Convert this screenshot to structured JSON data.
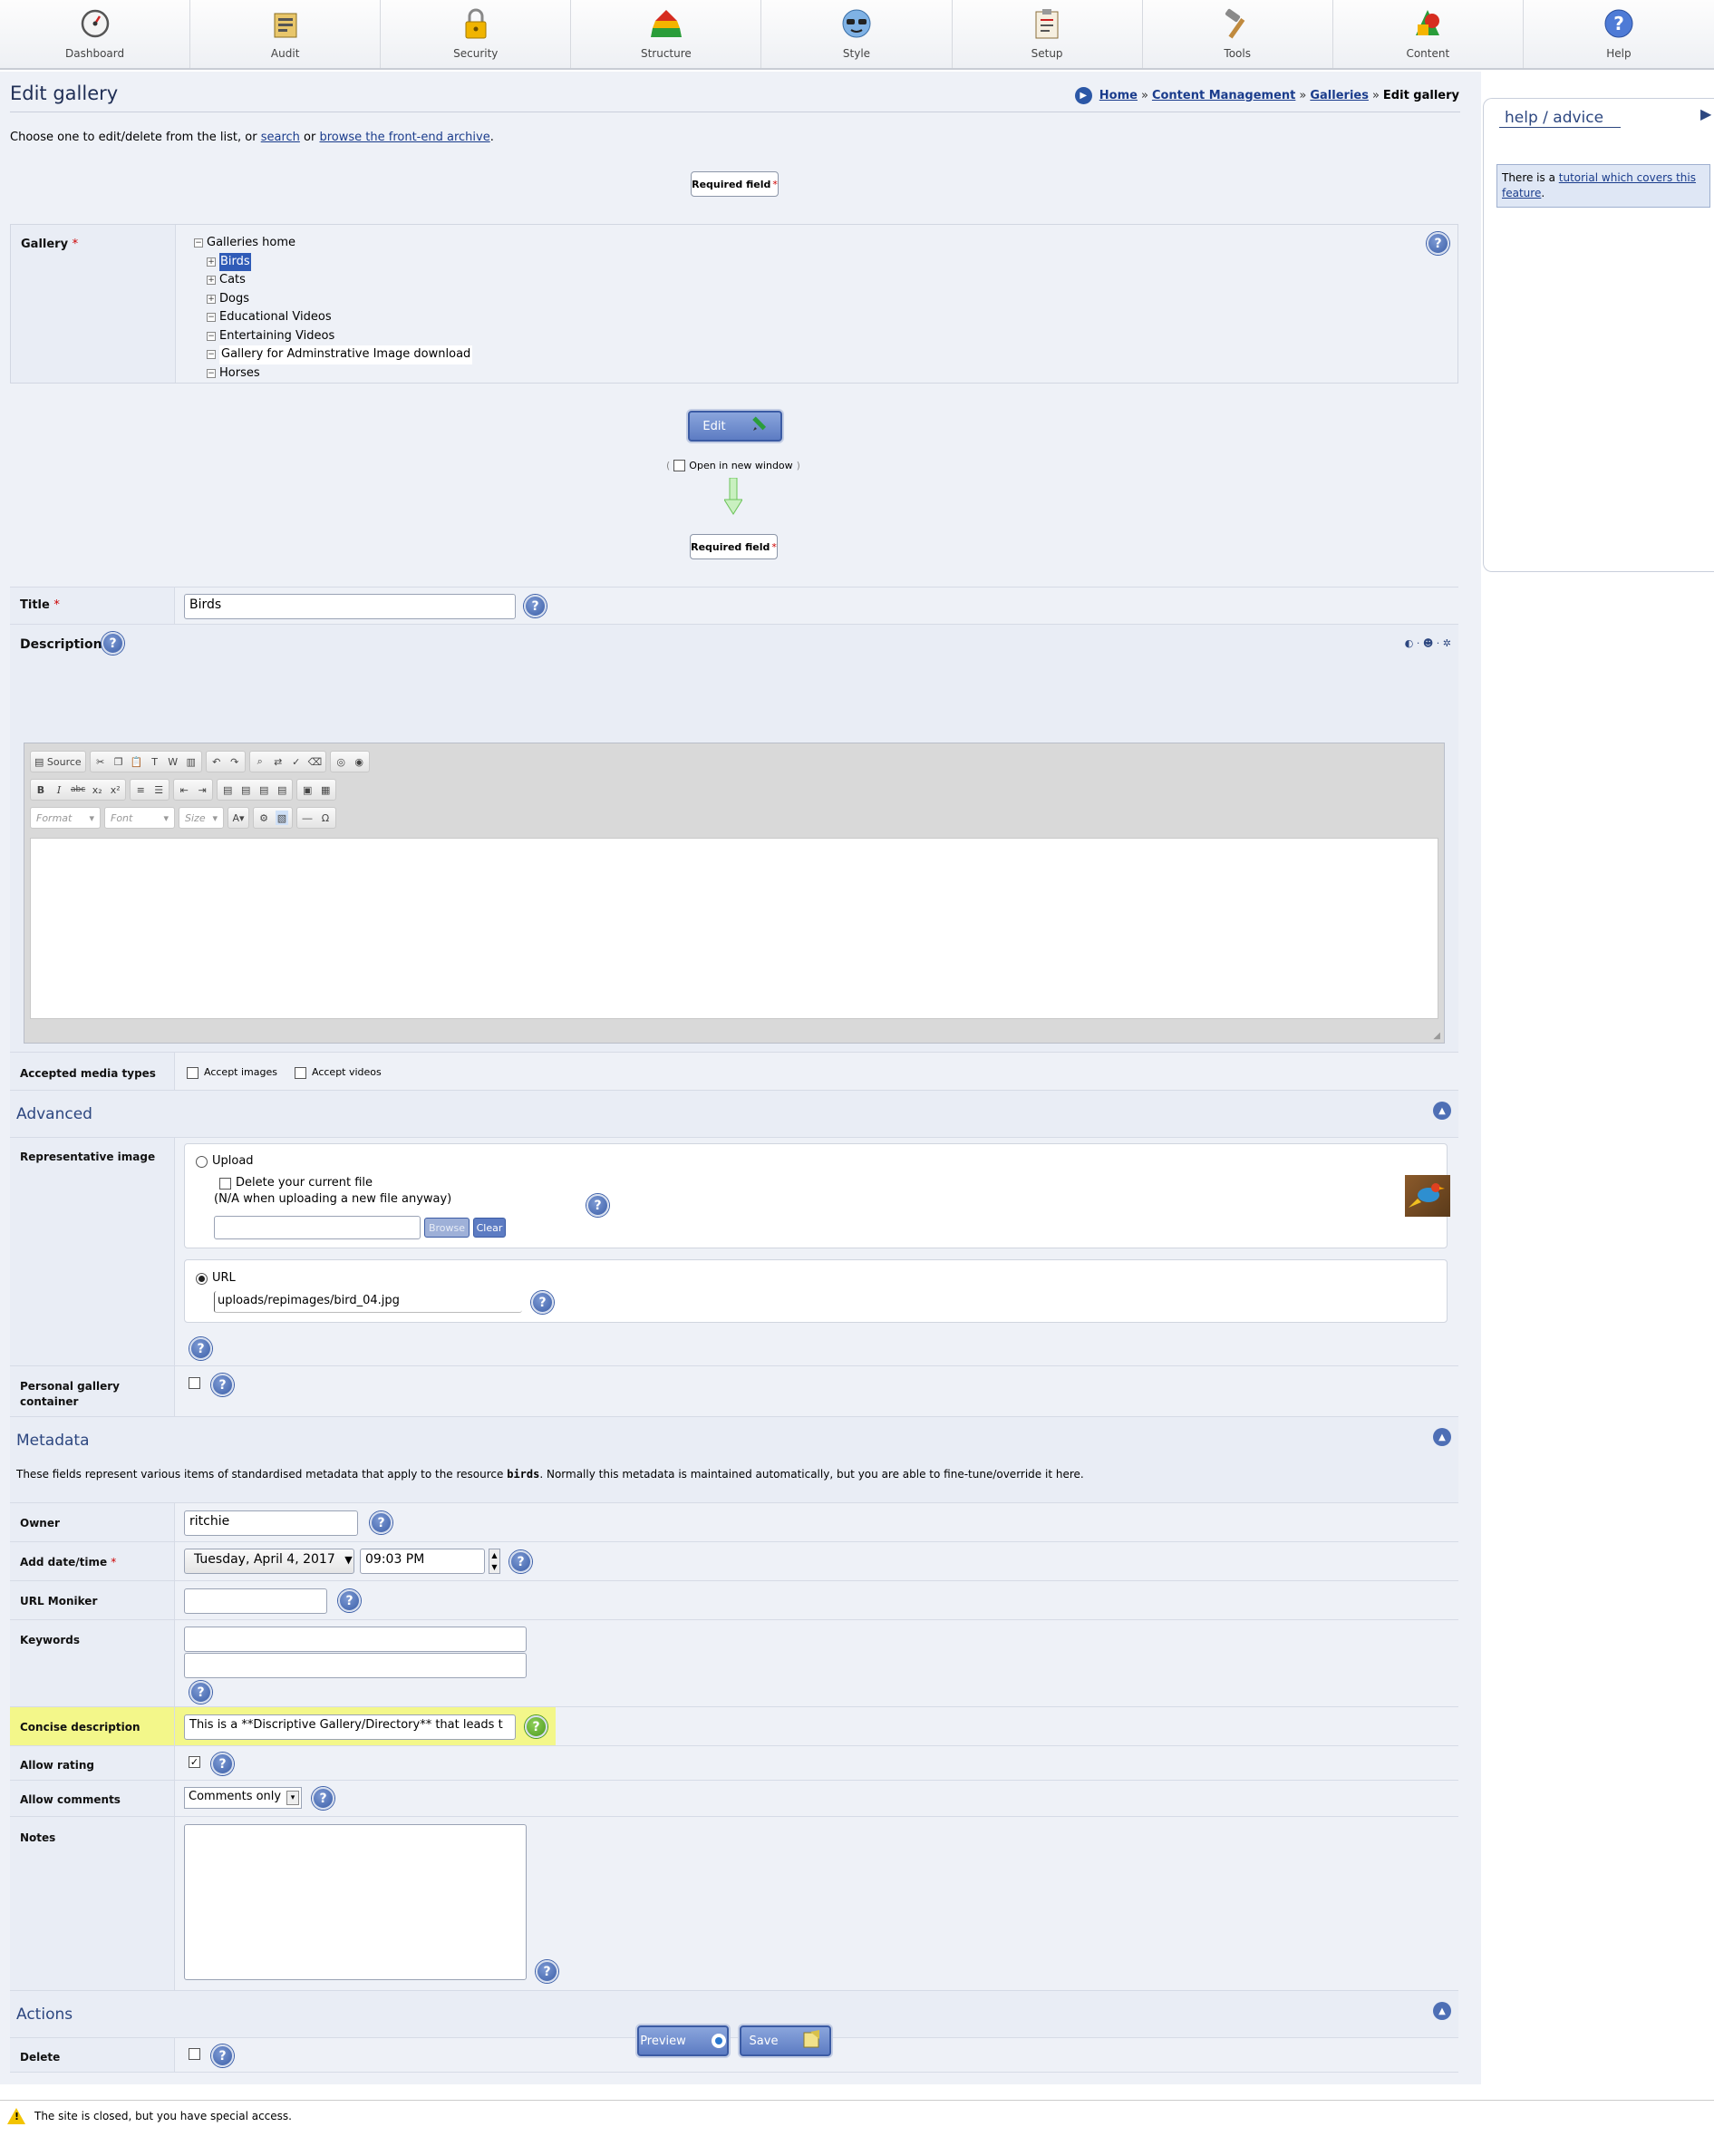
{
  "nav": [
    {
      "label": "Dashboard",
      "icon": "dashboard-icon"
    },
    {
      "label": "Audit",
      "icon": "audit-icon"
    },
    {
      "label": "Security",
      "icon": "padlock-icon"
    },
    {
      "label": "Structure",
      "icon": "pyramid-icon"
    },
    {
      "label": "Style",
      "icon": "sunglasses-face-icon"
    },
    {
      "label": "Setup",
      "icon": "clipboard-icon"
    },
    {
      "label": "Tools",
      "icon": "hammer-icon"
    },
    {
      "label": "Content",
      "icon": "shapes-icon"
    },
    {
      "label": "Help",
      "icon": "question-icon"
    }
  ],
  "page": {
    "title": "Edit gallery",
    "breadcrumb": [
      "Home",
      "Content Management",
      "Galleries",
      "Edit gallery"
    ],
    "intro_before": "Choose one to edit/delete from the list, or ",
    "intro_search": "search",
    "intro_or": " or ",
    "intro_archive": "browse the front-end archive",
    "intro_after": ".",
    "required_field": "Required field",
    "required_star": "*"
  },
  "gallery": {
    "label": "Gallery",
    "tree": [
      {
        "label": "Galleries home",
        "toggle": "−",
        "level": 0
      },
      {
        "label": "Birds",
        "toggle": "+",
        "level": 1,
        "selected": true
      },
      {
        "label": "Cats",
        "toggle": "+",
        "level": 1
      },
      {
        "label": "Dogs",
        "toggle": "+",
        "level": 1
      },
      {
        "label": "Educational Videos",
        "toggle": "−",
        "level": 1
      },
      {
        "label": "Entertaining Videos",
        "toggle": "−",
        "level": 1
      },
      {
        "label": "Gallery for Adminstrative Image download",
        "toggle": "−",
        "level": 1
      },
      {
        "label": "Horses",
        "toggle": "−",
        "level": 1
      }
    ]
  },
  "edit_button": "Edit",
  "open_new_window": {
    "before": "(",
    "label": "Open in new window",
    "after": ")"
  },
  "form": {
    "title_label": "Title",
    "title_value": "Birds",
    "description_label": "Description:",
    "editor": {
      "row1": [
        "Source"
      ],
      "format": "Format",
      "font": "Font",
      "size": "Size"
    },
    "media_label": "Accepted media types",
    "accept_images": "Accept images",
    "accept_videos": "Accept videos",
    "advanced_title": "Advanced",
    "rep_image_label": "Representative image",
    "upload_label": "Upload",
    "delete_current": "Delete your current file",
    "na_note": "(N/A when uploading a new file anyway)",
    "browse": "Browse",
    "clear": "Clear",
    "url_label": "URL",
    "url_value": "uploads/repimages/bird_04.jpg",
    "personal_label": "Personal gallery container",
    "metadata_title": "Metadata",
    "metadata_intro_before": "These fields represent various items of standardised metadata that apply to the resource ",
    "metadata_intro_resource": "birds",
    "metadata_intro_after": ". Normally this metadata is maintained automatically, but you are able to fine-tune/override it here.",
    "owner_label": "Owner",
    "owner_value": "ritchie",
    "add_date_label": "Add date/time",
    "date_value": "Tuesday, April 4, 2017",
    "time_value": "09:03 PM",
    "url_moniker_label": "URL Moniker",
    "keywords_label": "Keywords",
    "concise_label": "Concise description",
    "concise_value": "This is a **Discriptive Gallery/Directory** that leads t",
    "allow_rating_label": "Allow rating",
    "allow_comments_label": "Allow comments",
    "comments_value": "Comments only",
    "notes_label": "Notes",
    "actions_title": "Actions",
    "delete_label": "Delete",
    "preview_button": "Preview",
    "save_button": "Save"
  },
  "sidebar": {
    "heading": "help / advice",
    "text_before": "There is a ",
    "link": "tutorial which covers this feature",
    "text_after": "."
  },
  "footer": {
    "message": "The site is closed, but you have special access."
  },
  "colors": {
    "highlight": "#f3f78a",
    "accent": "#3c5fa8"
  }
}
